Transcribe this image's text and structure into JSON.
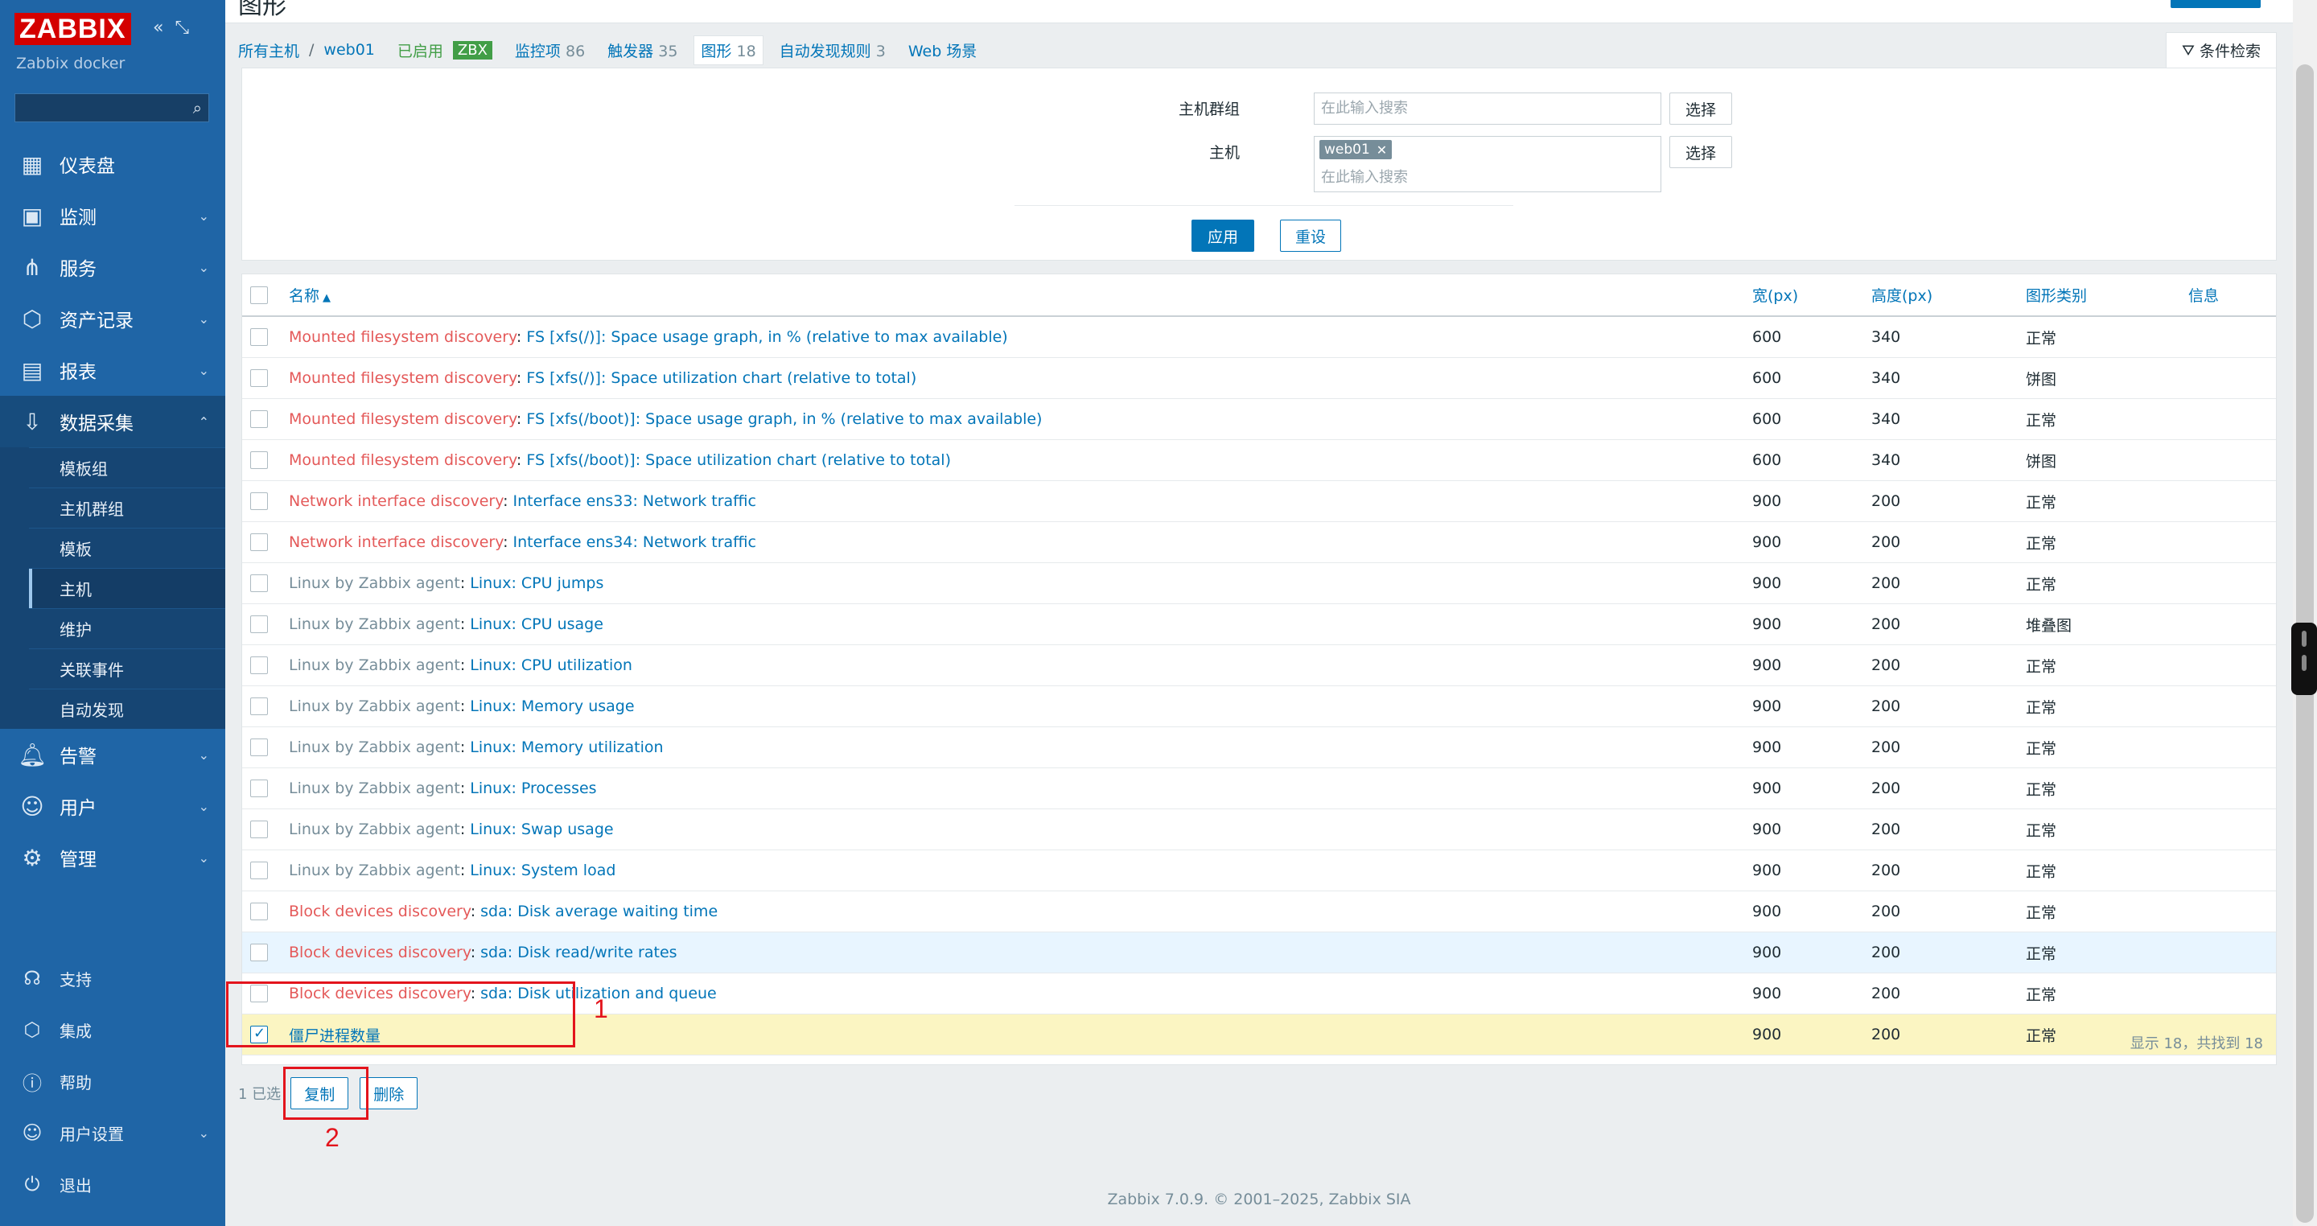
{
  "brand": {
    "logo": "ZABBIX",
    "server_name": "Zabbix docker",
    "collapse_icons": [
      "collapse-icon",
      "kiosk-icon"
    ]
  },
  "sidebar": {
    "search_placeholder": "",
    "menu": [
      {
        "label": "仪表盘",
        "icon": "dashboard-icon",
        "expandable": false
      },
      {
        "label": "监测",
        "icon": "monitoring-icon",
        "expandable": true
      },
      {
        "label": "服务",
        "icon": "services-icon",
        "expandable": true
      },
      {
        "label": "资产记录",
        "icon": "inventory-icon",
        "expandable": true
      },
      {
        "label": "报表",
        "icon": "reports-icon",
        "expandable": true
      },
      {
        "label": "数据采集",
        "icon": "data-collection-icon",
        "expandable": true,
        "open": true
      }
    ],
    "submenu": [
      "模板组",
      "主机群组",
      "模板",
      "主机",
      "维护",
      "关联事件",
      "自动发现"
    ],
    "submenu_active": "主机",
    "menu_after": [
      {
        "label": "告警",
        "icon": "alerts-icon"
      },
      {
        "label": "用户",
        "icon": "users-icon"
      },
      {
        "label": "管理",
        "icon": "administration-icon"
      }
    ],
    "bottom": [
      {
        "label": "支持",
        "icon": "support-icon"
      },
      {
        "label": "集成",
        "icon": "integrations-icon"
      },
      {
        "label": "帮助",
        "icon": "help-icon"
      },
      {
        "label": "用户设置",
        "icon": "user-settings-icon",
        "expandable": true
      },
      {
        "label": "退出",
        "icon": "signout-icon"
      }
    ]
  },
  "page": {
    "title": "图形"
  },
  "breadcrumb": {
    "all_hosts": "所有主机",
    "separator": "/",
    "host": "web01",
    "status": "已启用",
    "zbx": "ZBX",
    "tabs": [
      {
        "label": "监控项",
        "count": "86"
      },
      {
        "label": "触发器",
        "count": "35"
      },
      {
        "label": "图形",
        "count": "18",
        "current": true
      },
      {
        "label": "自动发现规则",
        "count": "3"
      },
      {
        "label": "Web 场景",
        "count": ""
      }
    ]
  },
  "filter": {
    "toggle_label": "条件检索",
    "host_group_label": "主机群组",
    "host_label": "主机",
    "placeholder": "在此输入搜索",
    "select_label": "选择",
    "host_chip": "web01",
    "apply": "应用",
    "reset": "重设"
  },
  "table": {
    "headers": {
      "name": "名称",
      "width": "宽(px)",
      "height": "高度(px)",
      "type": "图形类别",
      "info": "信息"
    },
    "rows": [
      {
        "prefix": "Mounted filesystem discovery",
        "prefix_style": "red",
        "name": "FS [xfs(/)]: Space usage graph, in % (relative to max available)",
        "width": "600",
        "height": "340",
        "type": "正常"
      },
      {
        "prefix": "Mounted filesystem discovery",
        "prefix_style": "red",
        "name": "FS [xfs(/)]: Space utilization chart (relative to total)",
        "width": "600",
        "height": "340",
        "type": "饼图"
      },
      {
        "prefix": "Mounted filesystem discovery",
        "prefix_style": "red",
        "name": "FS [xfs(/boot)]: Space usage graph, in % (relative to max available)",
        "width": "600",
        "height": "340",
        "type": "正常"
      },
      {
        "prefix": "Mounted filesystem discovery",
        "prefix_style": "red",
        "name": "FS [xfs(/boot)]: Space utilization chart (relative to total)",
        "width": "600",
        "height": "340",
        "type": "饼图"
      },
      {
        "prefix": "Network interface discovery",
        "prefix_style": "red",
        "name": "Interface ens33: Network traffic",
        "width": "900",
        "height": "200",
        "type": "正常"
      },
      {
        "prefix": "Network interface discovery",
        "prefix_style": "red",
        "name": "Interface ens34: Network traffic",
        "width": "900",
        "height": "200",
        "type": "正常"
      },
      {
        "prefix": "Linux by Zabbix agent",
        "prefix_style": "grey",
        "name": "Linux: CPU jumps",
        "width": "900",
        "height": "200",
        "type": "正常"
      },
      {
        "prefix": "Linux by Zabbix agent",
        "prefix_style": "grey",
        "name": "Linux: CPU usage",
        "width": "900",
        "height": "200",
        "type": "堆叠图"
      },
      {
        "prefix": "Linux by Zabbix agent",
        "prefix_style": "grey",
        "name": "Linux: CPU utilization",
        "width": "900",
        "height": "200",
        "type": "正常"
      },
      {
        "prefix": "Linux by Zabbix agent",
        "prefix_style": "grey",
        "name": "Linux: Memory usage",
        "width": "900",
        "height": "200",
        "type": "正常"
      },
      {
        "prefix": "Linux by Zabbix agent",
        "prefix_style": "grey",
        "name": "Linux: Memory utilization",
        "width": "900",
        "height": "200",
        "type": "正常"
      },
      {
        "prefix": "Linux by Zabbix agent",
        "prefix_style": "grey",
        "name": "Linux: Processes",
        "width": "900",
        "height": "200",
        "type": "正常"
      },
      {
        "prefix": "Linux by Zabbix agent",
        "prefix_style": "grey",
        "name": "Linux: Swap usage",
        "width": "900",
        "height": "200",
        "type": "正常"
      },
      {
        "prefix": "Linux by Zabbix agent",
        "prefix_style": "grey",
        "name": "Linux: System load",
        "width": "900",
        "height": "200",
        "type": "正常"
      },
      {
        "prefix": "Block devices discovery",
        "prefix_style": "red",
        "name": "sda: Disk average waiting time",
        "width": "900",
        "height": "200",
        "type": "正常"
      },
      {
        "prefix": "Block devices discovery",
        "prefix_style": "red",
        "name": "sda: Disk read/write rates",
        "width": "900",
        "height": "200",
        "type": "正常",
        "hover": true
      },
      {
        "prefix": "Block devices discovery",
        "prefix_style": "red",
        "name": "sda: Disk utilization and queue",
        "width": "900",
        "height": "200",
        "type": "正常"
      },
      {
        "prefix": "",
        "prefix_style": "",
        "name": "僵尸进程数量",
        "width": "900",
        "height": "200",
        "type": "正常",
        "checked": true
      }
    ],
    "summary": "显示 18，共找到 18"
  },
  "actions": {
    "selected": "1 已选",
    "copy": "复制",
    "delete": "删除"
  },
  "annotations": [
    "1",
    "2"
  ],
  "footer": "Zabbix 7.0.9. © 2001–2025, Zabbix SIA",
  "colors": {
    "sidebar": "#1f65a6",
    "accent": "#0275b8",
    "template_prefix": "#e45959",
    "selected_row": "#fbf5c2",
    "annotation": "#e3141c"
  }
}
